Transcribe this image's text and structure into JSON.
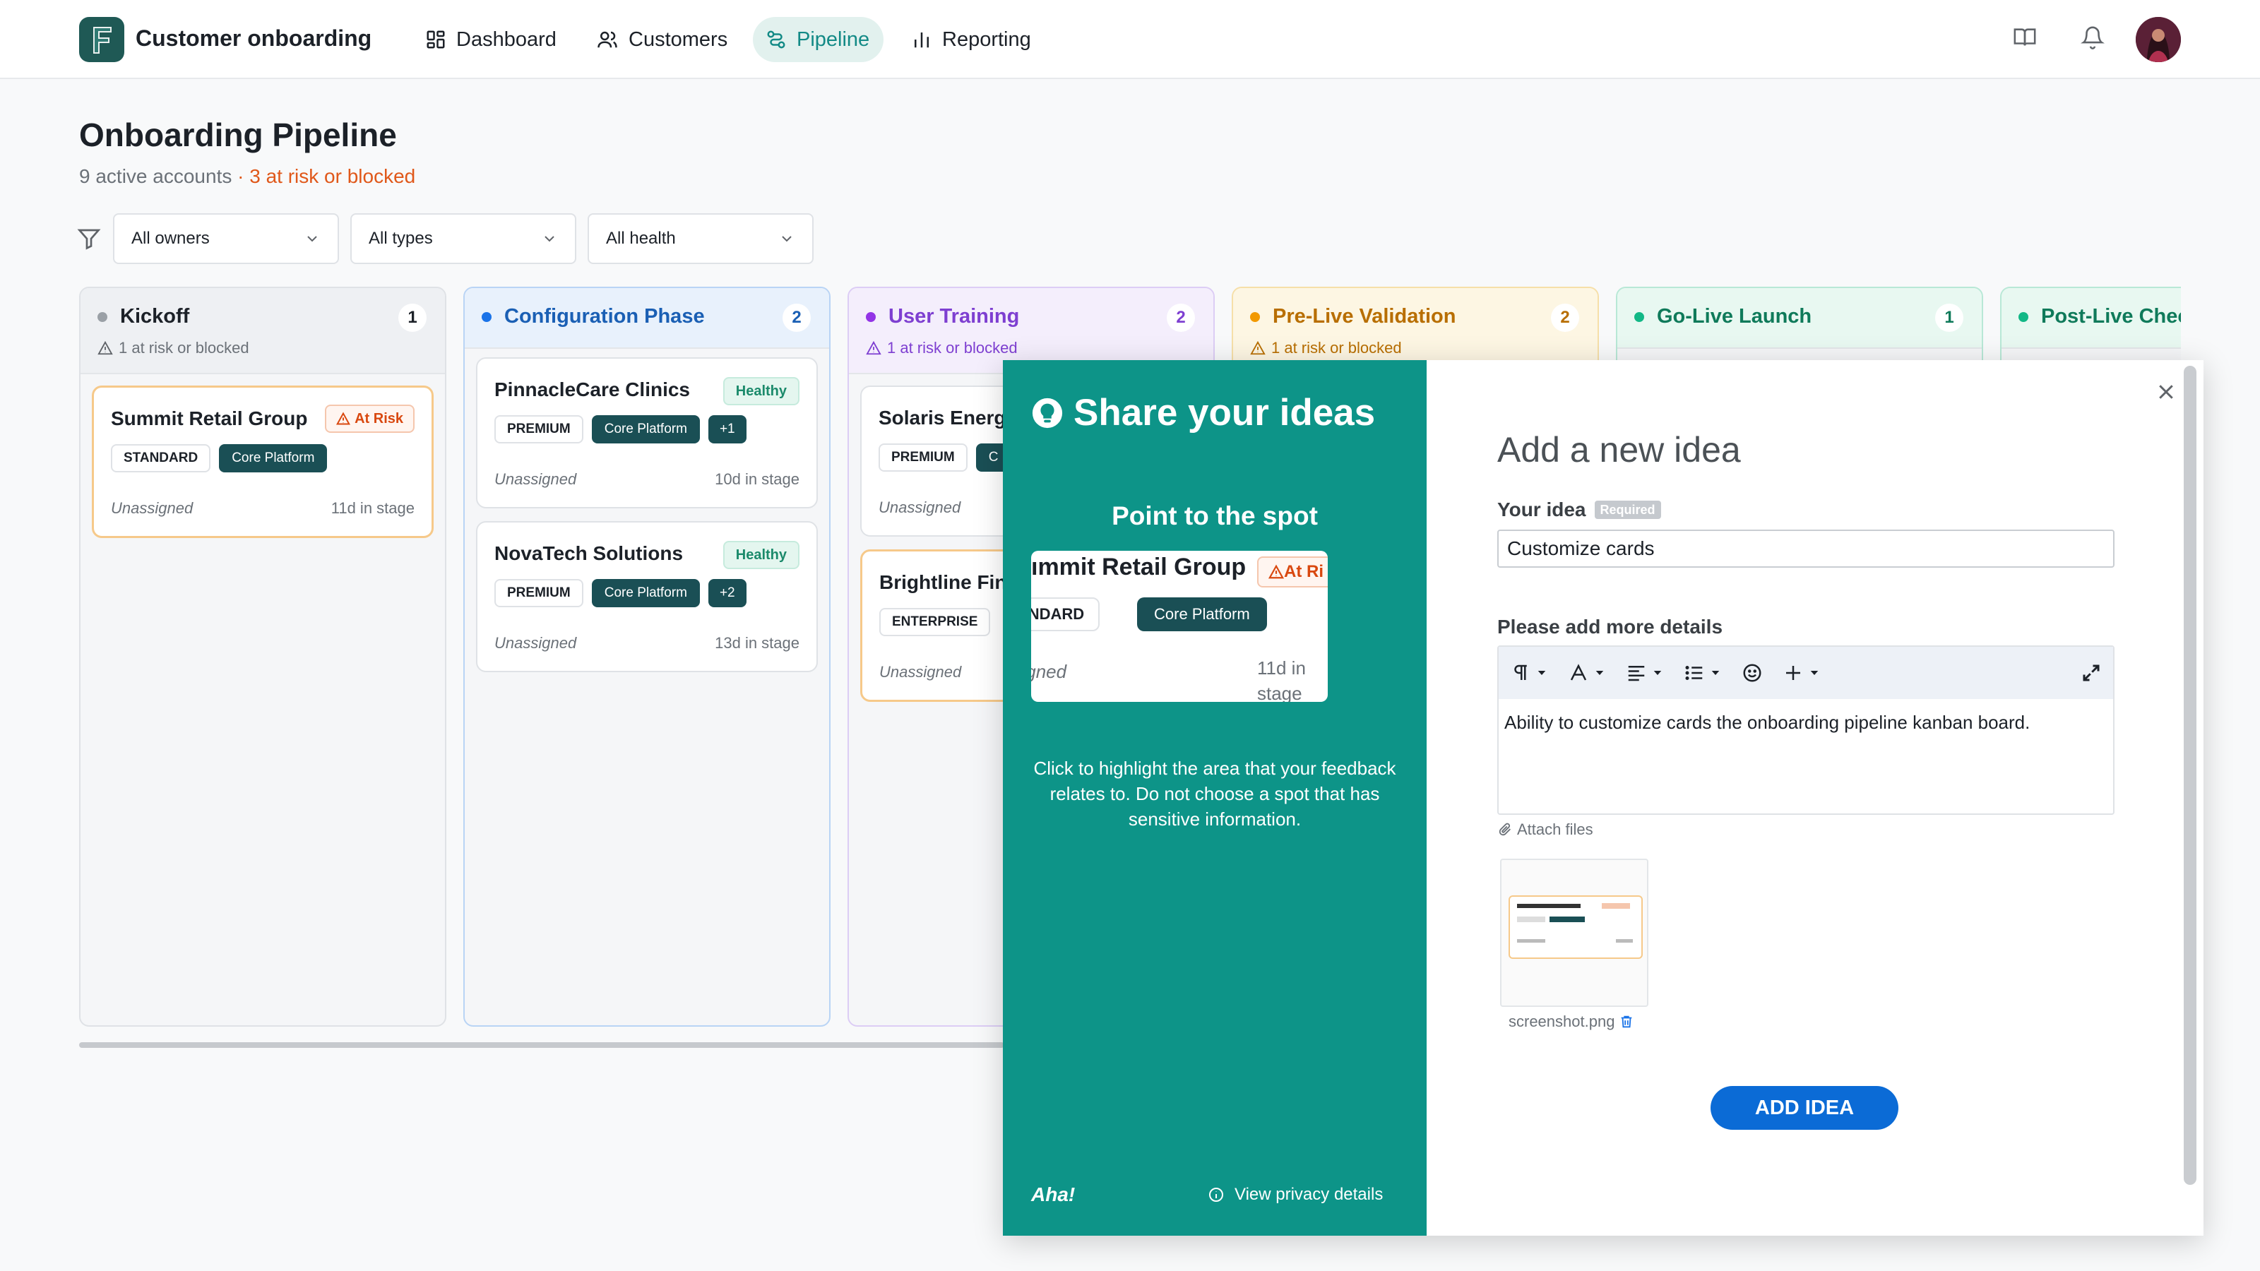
{
  "app": {
    "name": "Customer onboarding",
    "logo_letter": "F",
    "brand_color": "#1f5955"
  },
  "nav": [
    {
      "label": "Dashboard",
      "icon": "grid-icon"
    },
    {
      "label": "Customers",
      "icon": "users-icon"
    },
    {
      "label": "Pipeline",
      "icon": "pipeline-icon",
      "active": true
    },
    {
      "label": "Reporting",
      "icon": "bar-chart-icon"
    }
  ],
  "header_icons": [
    "book-icon",
    "bell-icon",
    "avatar"
  ],
  "page": {
    "title": "Onboarding Pipeline",
    "active_accounts": "9 active accounts",
    "risk_summary": "· 3 at risk or blocked"
  },
  "filters": {
    "owner": "All owners",
    "type": "All types",
    "health": "All health"
  },
  "columns": [
    {
      "title": "Kickoff",
      "count": "1",
      "risk": "1 at risk or blocked",
      "color": "#9aa0a6"
    },
    {
      "title": "Configuration Phase",
      "count": "2",
      "color": "#1a73e8"
    },
    {
      "title": "User Training",
      "count": "2",
      "risk": "1 at risk or blocked",
      "color": "#9334e6"
    },
    {
      "title": "Pre-Live Validation",
      "count": "2",
      "risk": "1 at risk or blocked",
      "color": "#f29900"
    },
    {
      "title": "Go-Live Launch",
      "count": "1",
      "color": "#12b886"
    },
    {
      "title": "Post-Live Chec",
      "color": "#12b886"
    }
  ],
  "cards": {
    "kickoff": [
      {
        "name": "Summit Retail Group",
        "badge": "At Risk",
        "tier": "STANDARD",
        "product": "Core Platform",
        "owner": "Unassigned",
        "age": "11d in stage"
      }
    ],
    "configuration": [
      {
        "name": "PinnacleCare Clinics",
        "badge": "Healthy",
        "tier": "PREMIUM",
        "product": "Core Platform",
        "extra": "+1",
        "owner": "Unassigned",
        "age": "10d in stage"
      },
      {
        "name": "NovaTech Solutions",
        "badge": "Healthy",
        "tier": "PREMIUM",
        "product": "Core Platform",
        "extra": "+2",
        "owner": "Unassigned",
        "age": "13d in stage"
      }
    ],
    "training": [
      {
        "name": "Solaris Energ",
        "tier": "PREMIUM",
        "product": "C",
        "owner": "Unassigned"
      },
      {
        "name": "Brightline Fin",
        "tier": "ENTERPRISE",
        "owner": "Unassigned"
      }
    ]
  },
  "feedback": {
    "share_title": "Share your ideas",
    "point_title": "Point to the spot",
    "preview": {
      "name": "ımmit Retail Group",
      "badge": "At Ri",
      "tier": "TANDARD",
      "product": "Core Platform",
      "owner": "assigned",
      "age": "11d in stage"
    },
    "help": "Click to highlight the area that your feedback relates to. Do not choose a spot that has sensitive information.",
    "brand": "Aha!",
    "privacy": "View privacy details",
    "add_title": "Add a new idea",
    "idea_label": "Your idea",
    "required": "Required",
    "idea_value": "Customize cards",
    "details_label": "Please add more details",
    "details_text": "Ability to customize cards the onboarding pipeline kanban board.",
    "attach": "Attach files",
    "file_name": "screenshot.png",
    "submit": "ADD IDEA",
    "accent": "#0d9488",
    "button_color": "#0b6bd6"
  }
}
